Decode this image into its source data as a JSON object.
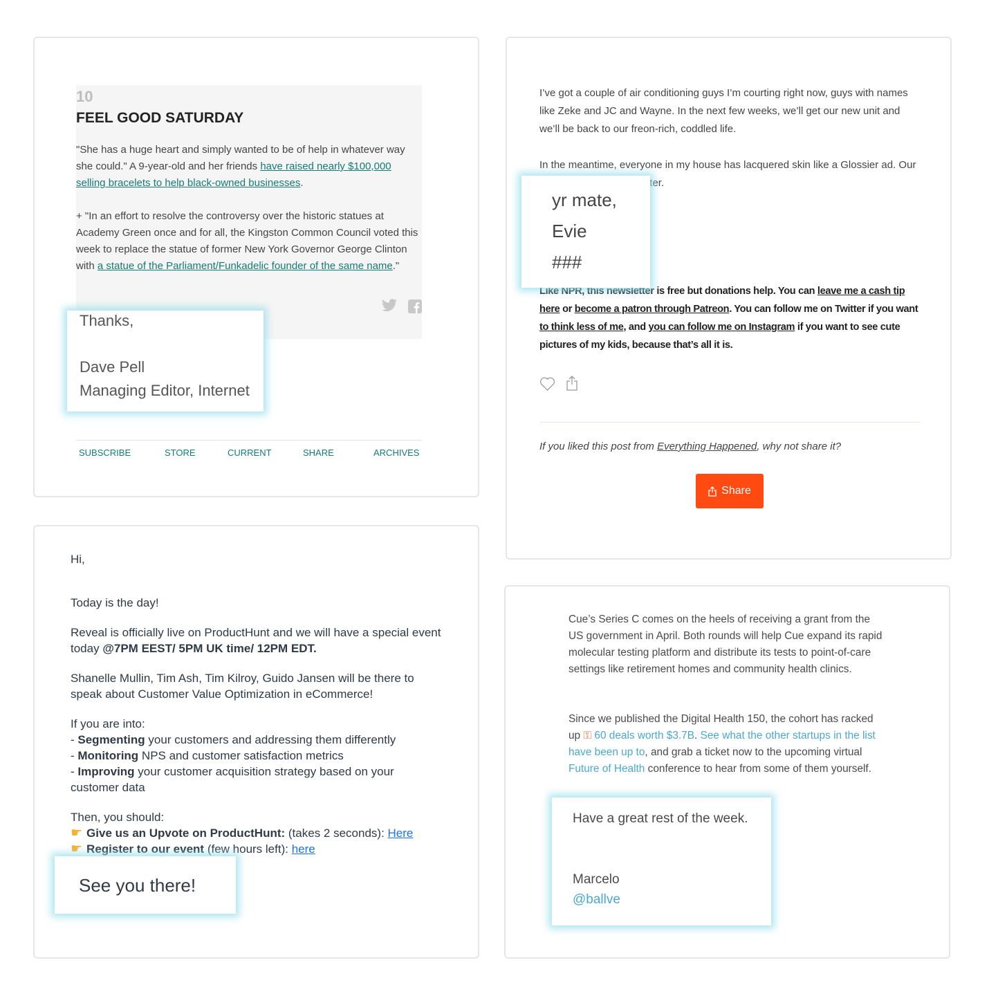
{
  "card1": {
    "number": "10",
    "title": "FEEL GOOD SATURDAY",
    "p1": [
      "\"She has a huge heart and simply wanted to be of help in whatever way she could.\" A 9-year-old and her friends ",
      "have raised nearly $100,000 selling bracelets to help black-owned businesses",
      "."
    ],
    "p2": [
      "+ \"In an effort to resolve the controversy over the historic statues at Academy Green once and for all, the Kingston Common Council voted this week to replace the statue of former New York Governor George Clinton with ",
      "a statue of the Parliament/Funkadelic founder of the same name",
      ".\""
    ],
    "signoff": {
      "greeting": "Thanks,",
      "name": "Dave Pell",
      "role": "Managing Editor, Internet"
    },
    "nav": [
      "SUBSCRIBE",
      "STORE",
      "CURRENT",
      "SHARE",
      "ARCHIVES"
    ]
  },
  "card2": {
    "p1": "I’ve got a couple of air conditioning guys I’m courting right now, guys with names like Zeke and JC and Wayne. In the next few weeks, we’ll get our new unit and we’ll be back to our freon-rich, coddled life.",
    "p2": "In the meantime, everyone in my house has lacquered skin like a Glossier ad. Our skin has never been better.",
    "signoff": [
      "yr mate,",
      "Evie",
      "###"
    ],
    "donate": [
      "Like NPR, this newsletter is free but donations help. You can ",
      "leave me a cash tip here",
      " or ",
      "become a patron through Patreon",
      ". You can follow me on Twitter if you want ",
      "to think less of me",
      ", and ",
      "you can follow me on Instagram",
      " if you want to see cute pictures of my kids, because that’s all it is."
    ],
    "share_prompt": [
      "If you liked this post from ",
      "Everything Happened",
      ", why not share it?"
    ],
    "share_button": "Share",
    "accent": "#ff4a12"
  },
  "card3": {
    "greeting": "Hi,",
    "p1": "Today is the day!",
    "p2": [
      "Reveal is officially live on ProductHunt and we will have a special event today ",
      "@7PM EEST/ 5PM UK time/ 12PM EDT."
    ],
    "p3": "Shanelle Mullin, Tim Ash, Tim Kilroy, Guido Jansen will be there to speak about Customer Value Optimization in eCommerce!",
    "into_intro": "If you are into:",
    "into": [
      {
        "bold": "Segmenting",
        "rest": " your customers and addressing them differently"
      },
      {
        "bold": "Monitoring",
        "rest": " NPS and customer satisfaction metrics"
      },
      {
        "bold": "Improving",
        "rest": " your customer acquisition strategy based on your customer data"
      }
    ],
    "then": "Then, you should:",
    "actions": [
      {
        "bold": "Give us an Upvote on ProductHunt:",
        "rest": " (takes 2 seconds): ",
        "link": "Here"
      },
      {
        "bold": "Register to our event",
        "rest": " (few hours left): ",
        "link": "here"
      }
    ],
    "signoff": "See you there!"
  },
  "card4": {
    "p1": "Cue’s Series C comes on the heels of receiving a grant from the US government in April. Both rounds will help Cue expand its rapid molecular testing platform and distribute its tests to point-of-care settings like retirement homes and community health clinics.",
    "p2": [
      "Since we published the Digital Health 150, the cohort has racked up ",
      "60 deals worth $3.7B",
      ". ",
      "See what the other startups in the list have been up to",
      ", and grab a ticket now to the upcoming virtual ",
      "Future of Health",
      " conference to hear from some of them yourself."
    ],
    "signoff": {
      "line": "Have a great rest of the week.",
      "name": "Marcelo",
      "handle": "@ballve"
    },
    "link_color": "#4aa8d0"
  }
}
